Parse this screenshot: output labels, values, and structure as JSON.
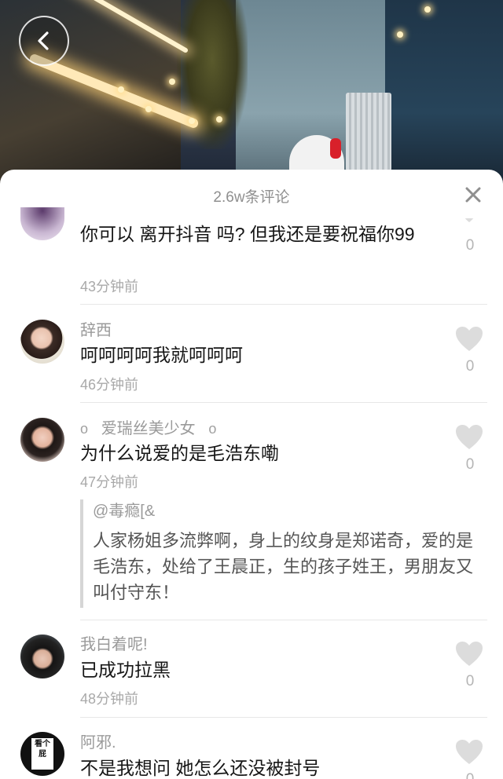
{
  "panel": {
    "title": "2.6w条评论"
  },
  "colors": {
    "panel_bg": "#ffffff",
    "username": "#9a9a9a",
    "text": "#161616",
    "time": "#a9a9a9",
    "like": "#d9d9d9"
  },
  "icons": {
    "back": "chevron-left-icon",
    "close": "close-icon",
    "like": "heart-icon"
  },
  "comments": [
    {
      "username": "",
      "text": "你可以 离开抖音 吗? 但我还是要祝福你99",
      "time": "43分钟前",
      "likes": "0"
    },
    {
      "username": "辞西",
      "text": "呵呵呵呵我就呵呵呵",
      "time": "46分钟前",
      "likes": "0"
    },
    {
      "username_prefix": "o",
      "username": "爱瑞丝美少女",
      "username_suffix": "o",
      "text": "为什么说爱的是毛浩东嘞",
      "time": "47分钟前",
      "likes": "0",
      "reply": {
        "username": "@毒瘾[&",
        "text": "人家杨姐多流弊啊，身上的纹身是郑诺奇，爱的是毛浩东，处给了王晨正，生的孩子姓王，男朋友又叫付守东！"
      }
    },
    {
      "username": "我白着呢!",
      "text": "已成功拉黑",
      "time": "48分钟前",
      "likes": "0"
    },
    {
      "username": "阿邪.",
      "text": "不是我想问 她怎么还没被封号",
      "avatar_text": "看个屁",
      "likes": "0"
    }
  ]
}
